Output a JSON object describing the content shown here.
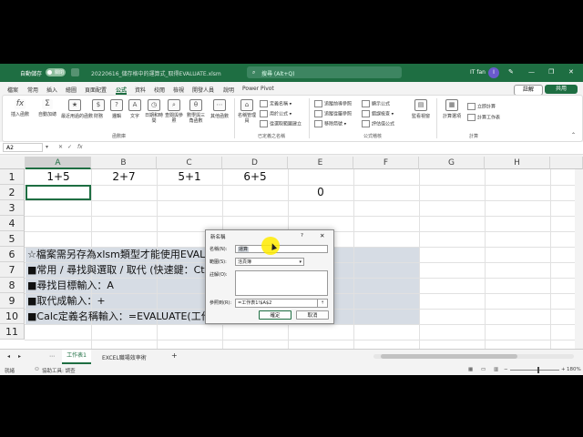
{
  "titlebar": {
    "autosave": "自動儲存",
    "autosave_state": "關閉",
    "filename": "20220616_儲存格中的運算式_取得EVALUATE.xlsm",
    "search_placeholder": "搜尋 (Alt+Q)",
    "user": "IT fan",
    "avatar": "I"
  },
  "tabs": [
    "檔案",
    "常用",
    "插入",
    "繪圖",
    "頁面配置",
    "公式",
    "資料",
    "校閱",
    "檢視",
    "開發人員",
    "說明",
    "Power Pivot"
  ],
  "active_tab": "公式",
  "comment_label": "註解",
  "share_label": "共用",
  "ribbon": {
    "insert_function": "插入函數",
    "autosum": "自動加總",
    "recent": "最近用過的函數",
    "financial": "財務",
    "logical": "邏輯",
    "text": "文字",
    "datetime": "日期和時間",
    "lookup": "查閱與參照",
    "math": "數學與三角函數",
    "more": "其他函數",
    "group_library": "函數庫",
    "name_manager": "名稱管理員",
    "define_name": "定義名稱",
    "use_in_formula": "用於公式",
    "create_from_sel": "從選取範圍建立",
    "group_names": "已定義之名稱",
    "trace_precedents": "追蹤前導參照",
    "trace_dependents": "追蹤從屬參照",
    "remove_arrows": "移除箭號",
    "show_formulas": "顯示公式",
    "error_checking": "錯誤檢查",
    "evaluate_formula": "評估值公式",
    "group_auditing": "公式稽核",
    "watch_window": "監看視窗",
    "calc_options": "計算選項",
    "calc_now": "立即計算",
    "calc_sheet": "計算工作表",
    "group_calc": "計算"
  },
  "formula_bar": {
    "name_box": "A2",
    "fx": "fx",
    "content": ""
  },
  "columns": [
    "A",
    "B",
    "C",
    "D",
    "E",
    "F",
    "G",
    "H"
  ],
  "rows": [
    "1",
    "2",
    "3",
    "4",
    "5",
    "6",
    "7",
    "8",
    "9",
    "10",
    "11"
  ],
  "cells": {
    "A1": "1+5",
    "B1": "2+7",
    "C1": "5+1",
    "D1": "6+5",
    "E2": "0",
    "A6": "☆檔案需另存為xlsm類型才能使用EVALUATE",
    "A7": "■常用 / 尋找與選取 / 取代 (快速鍵：Ctrl+H)",
    "A8": "■尋找目標輸入：A",
    "A9": "■取代成輸入：+",
    "A10": "■Calc定義名稱輸入：=EVALUATE(工作表1!$A$2)"
  },
  "dialog": {
    "title": "新名稱",
    "help": "?",
    "close": "✕",
    "name_label": "名稱(N):",
    "name_value": "運算",
    "scope_label": "範圍(S):",
    "scope_value": "活頁簿",
    "comment_label": "註解(O):",
    "ref_label": "參照到(R):",
    "ref_value": "=工作表1!$A$2",
    "ok": "確定",
    "cancel": "取消"
  },
  "sheets": [
    "工作表1",
    "EXCEL職場效率術"
  ],
  "active_sheet": "工作表1",
  "status": {
    "ready": "就緒",
    "accessibility": "協助工具: 調查",
    "zoom": "180%"
  }
}
